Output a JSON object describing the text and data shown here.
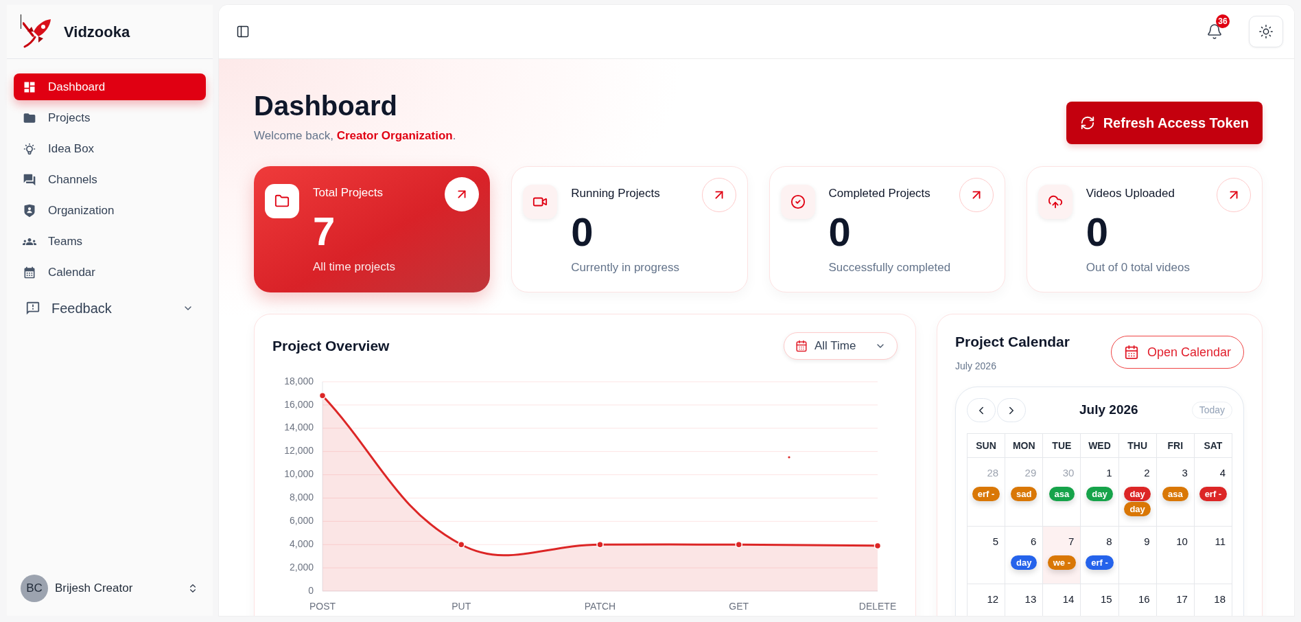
{
  "sidebar": {
    "brand": "Vidzooka",
    "items": [
      {
        "label": "Dashboard",
        "kind": "link",
        "selected": true
      },
      {
        "label": "Projects",
        "kind": "link",
        "selected": false
      },
      {
        "label": "Idea Box",
        "kind": "link",
        "selected": false
      },
      {
        "label": "Channels",
        "kind": "link",
        "selected": false
      },
      {
        "label": "Organization",
        "kind": "link",
        "selected": false
      },
      {
        "label": "Teams",
        "kind": "link",
        "selected": false
      },
      {
        "label": "Calendar",
        "kind": "link",
        "selected": false
      },
      {
        "label": "Feedback",
        "kind": "group",
        "selected": false,
        "expanded": false
      }
    ],
    "user": {
      "initials": "BC",
      "name": "Brijesh Creator"
    }
  },
  "header": {
    "notification_count": "36"
  },
  "page": {
    "title": "Dashboard",
    "welcome": "Welcome back, **Creator Organization**.",
    "refresh_button": "Refresh Access Token"
  },
  "stats": [
    {
      "title": "Total Projects",
      "value": "7",
      "caption": "All time projects",
      "highlighted": true
    },
    {
      "title": "Running Projects",
      "value": "0",
      "caption": "Currently in progress",
      "highlighted": false
    },
    {
      "title": "Completed Projects",
      "value": "0",
      "caption": "Successfully completed",
      "highlighted": false
    },
    {
      "title": "Videos Uploaded",
      "value": "0",
      "caption": "Out of 0 total videos",
      "highlighted": false
    }
  ],
  "overview": {
    "title": "Project Overview",
    "filter": "All Time",
    "chart_data": {
      "type": "area",
      "grid": true,
      "categories": [
        "POST",
        "PUT",
        "PATCH",
        "GET",
        "DELETE"
      ],
      "values": [
        16800,
        4000,
        4000,
        4000,
        3900
      ],
      "ylim": [
        0,
        18000
      ],
      "yticks": [
        0,
        {
          "value": 2000,
          "label": "2,000"
        },
        {
          "value": 4000,
          "label": "4,000"
        },
        {
          "value": 6000,
          "label": "6,000"
        },
        {
          "value": 8000,
          "label": "8,000"
        },
        {
          "value": 10000,
          "label": "10,000"
        },
        {
          "value": 12000,
          "label": "12,000"
        },
        {
          "value": 14000,
          "label": "14,000"
        },
        {
          "value": 16000,
          "label": "16,000"
        },
        {
          "value": 18000,
          "label": "18,000"
        }
      ]
    }
  },
  "calendar": {
    "title": "Project Calendar",
    "subtitle": "July 2026",
    "open_button": "Open Calendar",
    "month": "July 2026",
    "today_button": "Today",
    "weekdays": [
      "SUN",
      "MON",
      "TUE",
      "WED",
      "THU",
      "FRI",
      "SAT"
    ],
    "weeks": [
      [
        {
          "day": "28",
          "outside_month": true,
          "today": false,
          "events": [
            {
              "label": "erf -",
              "color": "#d97706"
            }
          ]
        },
        {
          "day": "29",
          "outside_month": true,
          "today": false,
          "events": [
            {
              "label": "sad",
              "color": "#d97706"
            }
          ]
        },
        {
          "day": "30",
          "outside_month": true,
          "today": false,
          "events": [
            {
              "label": "asa",
              "color": "#16a34a"
            }
          ]
        },
        {
          "day": "1",
          "outside_month": false,
          "today": false,
          "events": [
            {
              "label": "day",
              "color": "#16a34a"
            }
          ]
        },
        {
          "day": "2",
          "outside_month": false,
          "today": false,
          "events": [
            {
              "label": "day",
              "color": "#dc2626"
            },
            {
              "label": "day",
              "color": "#d97706"
            }
          ]
        },
        {
          "day": "3",
          "outside_month": false,
          "today": false,
          "events": [
            {
              "label": "asa",
              "color": "#d97706"
            }
          ]
        },
        {
          "day": "4",
          "outside_month": false,
          "today": false,
          "events": [
            {
              "label": "erf -",
              "color": "#dc2626"
            }
          ]
        }
      ],
      [
        {
          "day": "5",
          "outside_month": false,
          "today": false
        },
        {
          "day": "6",
          "outside_month": false,
          "today": false,
          "events": [
            {
              "label": "day",
              "color": "#2563eb"
            }
          ]
        },
        {
          "day": "7",
          "outside_month": false,
          "today": true,
          "events": [
            {
              "label": "we -",
              "color": "#d97706"
            }
          ]
        },
        {
          "day": "8",
          "outside_month": false,
          "today": false,
          "events": [
            {
              "label": "erf -",
              "color": "#2563eb"
            }
          ]
        },
        {
          "day": "9",
          "outside_month": false,
          "today": false
        },
        {
          "day": "10",
          "outside_month": false,
          "today": false
        },
        {
          "day": "11",
          "outside_month": false,
          "today": false
        }
      ],
      [
        {
          "day": "12",
          "outside_month": false,
          "today": false
        },
        {
          "day": "13",
          "outside_month": false,
          "today": false
        },
        {
          "day": "14",
          "outside_month": false,
          "today": false
        },
        {
          "day": "15",
          "outside_month": false,
          "today": false
        },
        {
          "day": "16",
          "outside_month": false,
          "today": false
        },
        {
          "day": "17",
          "outside_month": false,
          "today": false
        },
        {
          "day": "18",
          "outside_month": false,
          "today": false
        }
      ]
    ]
  }
}
